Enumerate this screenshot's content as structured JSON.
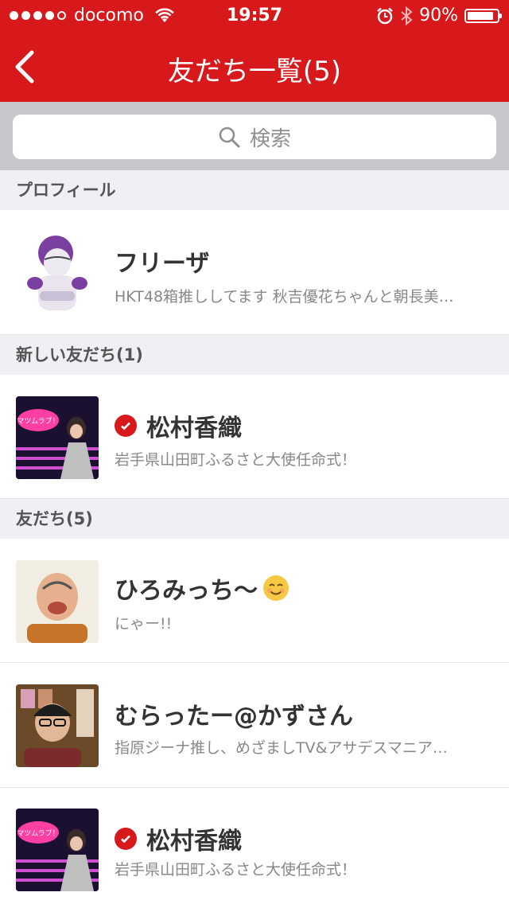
{
  "statusbar": {
    "carrier": "docomo",
    "time": "19:57",
    "battery": "90%",
    "battery_level": 0.9,
    "signal_bars_filled": 4,
    "signal_bars_total": 5
  },
  "nav": {
    "title": "友だち一覧(5)"
  },
  "search": {
    "placeholder": "検索"
  },
  "sections": {
    "profile": "プロフィール",
    "new_friends": "新しい友だち(1)",
    "friends": "友だち(5)"
  },
  "profile": {
    "name": "フリーザ",
    "status": "HKT48箱推ししてます 秋吉優花ちゃんと朝長美…"
  },
  "new_friends": [
    {
      "name": "松村香織",
      "status": "岩手県山田町ふるさと大使任命式！",
      "verified": true
    }
  ],
  "friends": [
    {
      "name": "ひろみっち〜",
      "status": "にゃー!!",
      "verified": false
    },
    {
      "name": "むらったー@かずさん",
      "status": "指原ジーナ推し、めざましTV&アサデスマニア…",
      "verified": false
    },
    {
      "name": "松村香織",
      "status": "岩手県山田町ふるさと大使任命式！",
      "verified": true
    }
  ],
  "colors": {
    "brand_red": "#d7191c",
    "section_bg": "#efeff4",
    "search_bg": "#c8c7cc"
  },
  "icons": [
    "back-chevron-icon",
    "search-icon",
    "wifi-icon",
    "alarm-icon",
    "bluetooth-icon",
    "battery-icon",
    "verified-check-icon"
  ]
}
